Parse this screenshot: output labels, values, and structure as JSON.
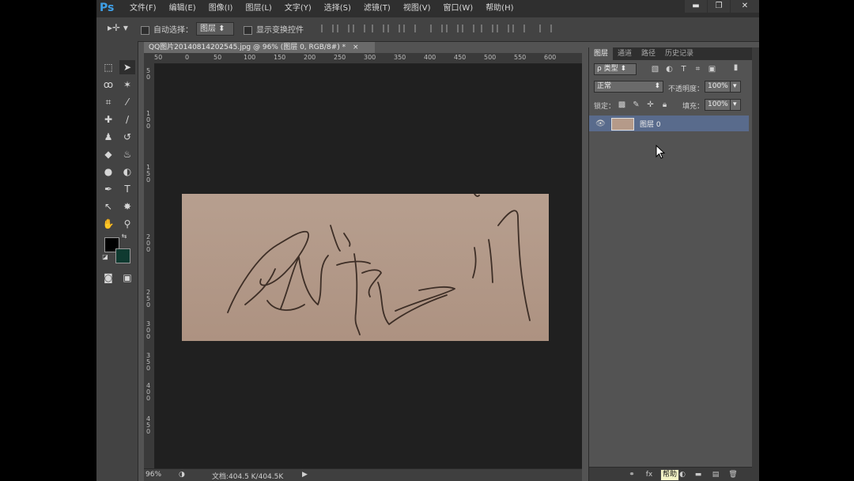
{
  "app": {
    "logo": "Ps",
    "menus": [
      "文件(F)",
      "编辑(E)",
      "图像(I)",
      "图层(L)",
      "文字(Y)",
      "选择(S)",
      "滤镜(T)",
      "视图(V)",
      "窗口(W)",
      "帮助(H)"
    ],
    "window_controls": [
      "▬",
      "❐",
      "✕"
    ]
  },
  "options_bar": {
    "auto_select_label": "自动选择：",
    "auto_select_value": "图层",
    "show_transform_label": "显示变换控件"
  },
  "document": {
    "tab_title": "QQ图片20140814202545.jpg @ 96% (图层 0, RGB/8#) *",
    "h_ruler_ticks": [
      "50",
      "0",
      "50",
      "100",
      "150",
      "200",
      "250",
      "300",
      "350",
      "400",
      "450",
      "500",
      "550",
      "600"
    ],
    "v_ruler_ticks": [
      "5\n0",
      "1\n0\n0",
      "1\n5\n0",
      "2\n0\n0",
      "2\n5\n0",
      "3\n0\n0",
      "3\n5\n0",
      "4\n0\n0",
      "4\n5\n0"
    ],
    "zoom": "96%",
    "doc_info": "文档:404.5 K/404.5K"
  },
  "layers_panel": {
    "tabs": [
      "图层",
      "通道",
      "路径",
      "历史记录"
    ],
    "filter_kind": "类型",
    "blend_mode": "正常",
    "opacity_label": "不透明度：",
    "opacity_value": "100%",
    "lock_label": "锁定：",
    "fill_label": "填充：",
    "fill_value": "100%",
    "layer_name": "图层 0",
    "help_tip": "帮助"
  },
  "colors": {
    "foreground": "#000000",
    "background": "#0f3a30",
    "accent_selection": "#596b8c",
    "canvas_paper": "#b59a89"
  }
}
